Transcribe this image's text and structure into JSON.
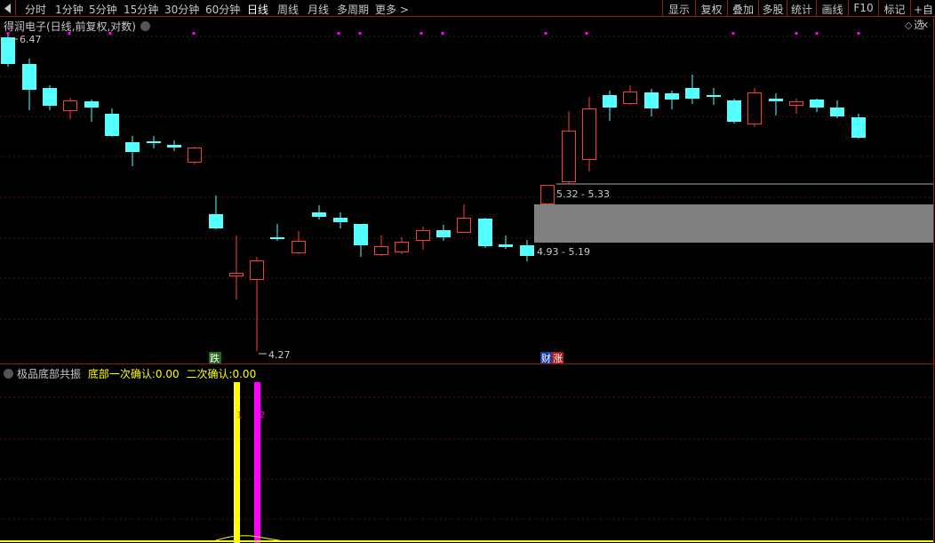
{
  "toolbar": {
    "periods": [
      "分时",
      "1分钟",
      "5分钟",
      "15分钟",
      "30分钟",
      "60分钟",
      "日线",
      "周线",
      "月线",
      "多周期",
      "更多 >"
    ],
    "active_period": "日线",
    "right_buttons": [
      "显示",
      "复权",
      "叠加",
      "多股",
      "统计",
      "画线",
      "F10",
      "标记",
      "+自选"
    ]
  },
  "main_chart": {
    "title": "得润电子(日线,前复权,对数)",
    "high_label": "6.47",
    "low_label": "4.27",
    "zone_upper_label": "5.32 - 5.33",
    "zone_lower_label": "4.93 - 5.19",
    "marker_fall": "跌",
    "marker_finance": "财",
    "marker_rise": "涨",
    "colors": {
      "up": "#ff3a3a",
      "down": "#54ffff",
      "zone": "#808080",
      "dot": "#ff00ff"
    }
  },
  "indicator": {
    "name": "极品底部共振",
    "line1_label": "底部一次确认:",
    "line1_value": "0.00",
    "line2_label": "二次确认:",
    "line2_value": "0.00",
    "bar1_label": "1",
    "bar2_label": "2",
    "colors": {
      "bar1": "#ffff00",
      "bar2": "#ff00ff"
    }
  }
}
